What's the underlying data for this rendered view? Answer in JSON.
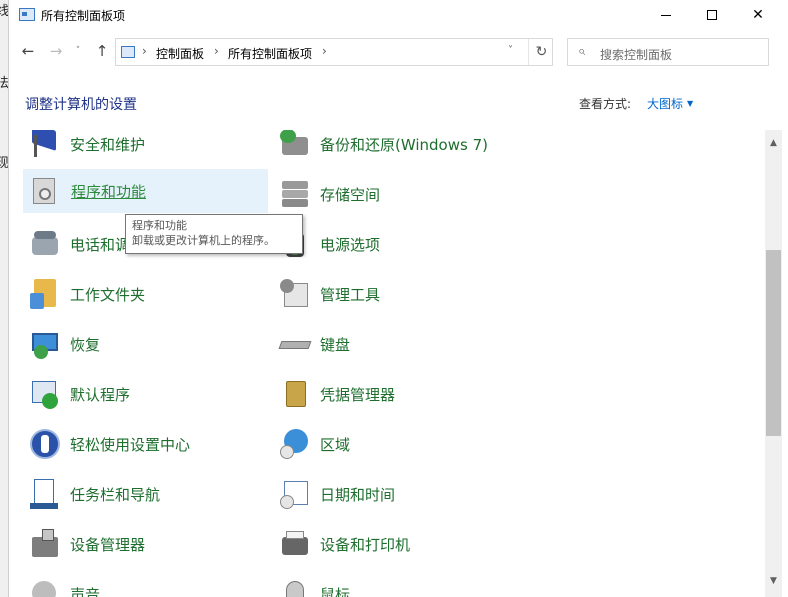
{
  "background_fragments": [
    "现",
    "线",
    "法"
  ],
  "window": {
    "title": "所有控制面板项",
    "minimize_glyph": "",
    "maximize_glyph": "",
    "close_glyph": "✕"
  },
  "nav": {
    "back": "←",
    "forward": "→",
    "recent": "˅",
    "up": "↑",
    "breadcrumb": [
      "控制面板",
      "所有控制面板项"
    ],
    "separator": "›",
    "dropdown": "˅",
    "refresh": "↻",
    "search_icon": "⌕",
    "search_placeholder": "搜索控制面板"
  },
  "header": {
    "title": "调整计算机的设置",
    "view_by_label": "查看方式:",
    "view_by_value": "大图标",
    "caret": "▼"
  },
  "items_left": [
    {
      "label": "安全和维护",
      "icon": "security-flag-icon"
    },
    {
      "label": "程序和功能",
      "icon": "programs-features-icon"
    },
    {
      "label": "电话和调制解调器",
      "icon": "phone-modem-icon"
    },
    {
      "label": "工作文件夹",
      "icon": "work-folders-icon"
    },
    {
      "label": "恢复",
      "icon": "recovery-icon"
    },
    {
      "label": "默认程序",
      "icon": "default-programs-icon"
    },
    {
      "label": "轻松使用设置中心",
      "icon": "ease-of-access-icon"
    },
    {
      "label": "任务栏和导航",
      "icon": "taskbar-icon"
    },
    {
      "label": "设备管理器",
      "icon": "device-manager-icon"
    },
    {
      "label": "声音",
      "icon": "sound-icon"
    }
  ],
  "items_right": [
    {
      "label": "备份和还原(Windows 7)",
      "icon": "backup-restore-icon"
    },
    {
      "label": "存储空间",
      "icon": "storage-spaces-icon"
    },
    {
      "label": "电源选项",
      "icon": "power-options-icon"
    },
    {
      "label": "管理工具",
      "icon": "admin-tools-icon"
    },
    {
      "label": "键盘",
      "icon": "keyboard-icon"
    },
    {
      "label": "凭据管理器",
      "icon": "credential-manager-icon"
    },
    {
      "label": "区域",
      "icon": "region-icon"
    },
    {
      "label": "日期和时间",
      "icon": "date-time-icon"
    },
    {
      "label": "设备和打印机",
      "icon": "devices-printers-icon"
    },
    {
      "label": "鼠标",
      "icon": "mouse-icon"
    }
  ],
  "tooltip": {
    "title": "程序和功能",
    "description": "卸载或更改计算机上的程序。"
  },
  "scrollbar": {
    "up": "▲",
    "down": "▼"
  },
  "hovered_item": "程序和功能"
}
